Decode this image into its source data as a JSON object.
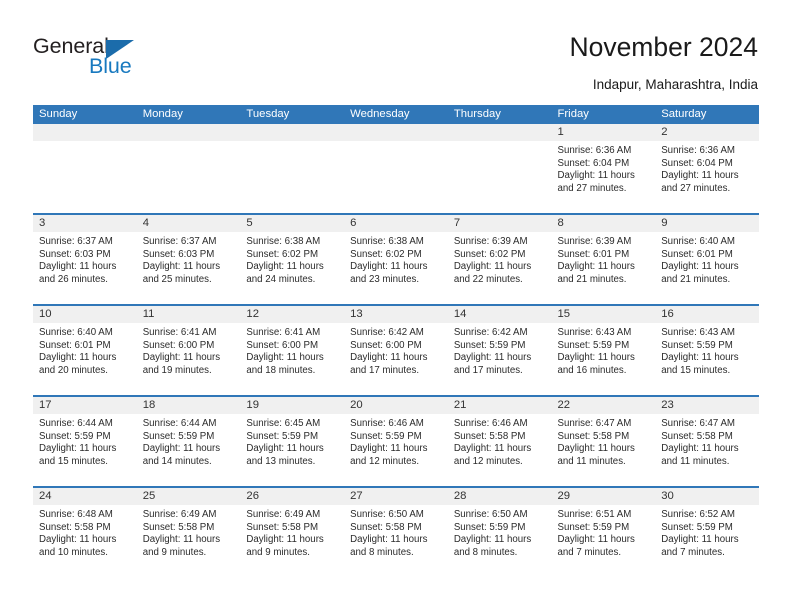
{
  "brand": {
    "name_part1": "General",
    "name_part2": "Blue",
    "triangle_color": "#1b6cab",
    "blue_text_color": "#1879bf"
  },
  "header": {
    "title": "November 2024",
    "location": "Indapur, Maharashtra, India"
  },
  "theme": {
    "header_blue": "#3077b8",
    "daynum_band": "#f0f0f0",
    "text": "#2b2b2b"
  },
  "weekdays": [
    "Sunday",
    "Monday",
    "Tuesday",
    "Wednesday",
    "Thursday",
    "Friday",
    "Saturday"
  ],
  "labels": {
    "sunrise_prefix": "Sunrise:",
    "sunset_prefix": "Sunset:",
    "daylight_prefix": "Daylight:"
  },
  "weeks": [
    [
      {
        "day": "",
        "empty": true
      },
      {
        "day": "",
        "empty": true
      },
      {
        "day": "",
        "empty": true
      },
      {
        "day": "",
        "empty": true
      },
      {
        "day": "",
        "empty": true
      },
      {
        "day": "1",
        "sunrise": "Sunrise: 6:36 AM",
        "sunset": "Sunset: 6:04 PM",
        "daylight": "Daylight: 11 hours and 27 minutes."
      },
      {
        "day": "2",
        "sunrise": "Sunrise: 6:36 AM",
        "sunset": "Sunset: 6:04 PM",
        "daylight": "Daylight: 11 hours and 27 minutes."
      }
    ],
    [
      {
        "day": "3",
        "sunrise": "Sunrise: 6:37 AM",
        "sunset": "Sunset: 6:03 PM",
        "daylight": "Daylight: 11 hours and 26 minutes."
      },
      {
        "day": "4",
        "sunrise": "Sunrise: 6:37 AM",
        "sunset": "Sunset: 6:03 PM",
        "daylight": "Daylight: 11 hours and 25 minutes."
      },
      {
        "day": "5",
        "sunrise": "Sunrise: 6:38 AM",
        "sunset": "Sunset: 6:02 PM",
        "daylight": "Daylight: 11 hours and 24 minutes."
      },
      {
        "day": "6",
        "sunrise": "Sunrise: 6:38 AM",
        "sunset": "Sunset: 6:02 PM",
        "daylight": "Daylight: 11 hours and 23 minutes."
      },
      {
        "day": "7",
        "sunrise": "Sunrise: 6:39 AM",
        "sunset": "Sunset: 6:02 PM",
        "daylight": "Daylight: 11 hours and 22 minutes."
      },
      {
        "day": "8",
        "sunrise": "Sunrise: 6:39 AM",
        "sunset": "Sunset: 6:01 PM",
        "daylight": "Daylight: 11 hours and 21 minutes."
      },
      {
        "day": "9",
        "sunrise": "Sunrise: 6:40 AM",
        "sunset": "Sunset: 6:01 PM",
        "daylight": "Daylight: 11 hours and 21 minutes."
      }
    ],
    [
      {
        "day": "10",
        "sunrise": "Sunrise: 6:40 AM",
        "sunset": "Sunset: 6:01 PM",
        "daylight": "Daylight: 11 hours and 20 minutes."
      },
      {
        "day": "11",
        "sunrise": "Sunrise: 6:41 AM",
        "sunset": "Sunset: 6:00 PM",
        "daylight": "Daylight: 11 hours and 19 minutes."
      },
      {
        "day": "12",
        "sunrise": "Sunrise: 6:41 AM",
        "sunset": "Sunset: 6:00 PM",
        "daylight": "Daylight: 11 hours and 18 minutes."
      },
      {
        "day": "13",
        "sunrise": "Sunrise: 6:42 AM",
        "sunset": "Sunset: 6:00 PM",
        "daylight": "Daylight: 11 hours and 17 minutes."
      },
      {
        "day": "14",
        "sunrise": "Sunrise: 6:42 AM",
        "sunset": "Sunset: 5:59 PM",
        "daylight": "Daylight: 11 hours and 17 minutes."
      },
      {
        "day": "15",
        "sunrise": "Sunrise: 6:43 AM",
        "sunset": "Sunset: 5:59 PM",
        "daylight": "Daylight: 11 hours and 16 minutes."
      },
      {
        "day": "16",
        "sunrise": "Sunrise: 6:43 AM",
        "sunset": "Sunset: 5:59 PM",
        "daylight": "Daylight: 11 hours and 15 minutes."
      }
    ],
    [
      {
        "day": "17",
        "sunrise": "Sunrise: 6:44 AM",
        "sunset": "Sunset: 5:59 PM",
        "daylight": "Daylight: 11 hours and 15 minutes."
      },
      {
        "day": "18",
        "sunrise": "Sunrise: 6:44 AM",
        "sunset": "Sunset: 5:59 PM",
        "daylight": "Daylight: 11 hours and 14 minutes."
      },
      {
        "day": "19",
        "sunrise": "Sunrise: 6:45 AM",
        "sunset": "Sunset: 5:59 PM",
        "daylight": "Daylight: 11 hours and 13 minutes."
      },
      {
        "day": "20",
        "sunrise": "Sunrise: 6:46 AM",
        "sunset": "Sunset: 5:59 PM",
        "daylight": "Daylight: 11 hours and 12 minutes."
      },
      {
        "day": "21",
        "sunrise": "Sunrise: 6:46 AM",
        "sunset": "Sunset: 5:58 PM",
        "daylight": "Daylight: 11 hours and 12 minutes."
      },
      {
        "day": "22",
        "sunrise": "Sunrise: 6:47 AM",
        "sunset": "Sunset: 5:58 PM",
        "daylight": "Daylight: 11 hours and 11 minutes."
      },
      {
        "day": "23",
        "sunrise": "Sunrise: 6:47 AM",
        "sunset": "Sunset: 5:58 PM",
        "daylight": "Daylight: 11 hours and 11 minutes."
      }
    ],
    [
      {
        "day": "24",
        "sunrise": "Sunrise: 6:48 AM",
        "sunset": "Sunset: 5:58 PM",
        "daylight": "Daylight: 11 hours and 10 minutes."
      },
      {
        "day": "25",
        "sunrise": "Sunrise: 6:49 AM",
        "sunset": "Sunset: 5:58 PM",
        "daylight": "Daylight: 11 hours and 9 minutes."
      },
      {
        "day": "26",
        "sunrise": "Sunrise: 6:49 AM",
        "sunset": "Sunset: 5:58 PM",
        "daylight": "Daylight: 11 hours and 9 minutes."
      },
      {
        "day": "27",
        "sunrise": "Sunrise: 6:50 AM",
        "sunset": "Sunset: 5:58 PM",
        "daylight": "Daylight: 11 hours and 8 minutes."
      },
      {
        "day": "28",
        "sunrise": "Sunrise: 6:50 AM",
        "sunset": "Sunset: 5:59 PM",
        "daylight": "Daylight: 11 hours and 8 minutes."
      },
      {
        "day": "29",
        "sunrise": "Sunrise: 6:51 AM",
        "sunset": "Sunset: 5:59 PM",
        "daylight": "Daylight: 11 hours and 7 minutes."
      },
      {
        "day": "30",
        "sunrise": "Sunrise: 6:52 AM",
        "sunset": "Sunset: 5:59 PM",
        "daylight": "Daylight: 11 hours and 7 minutes."
      }
    ]
  ]
}
